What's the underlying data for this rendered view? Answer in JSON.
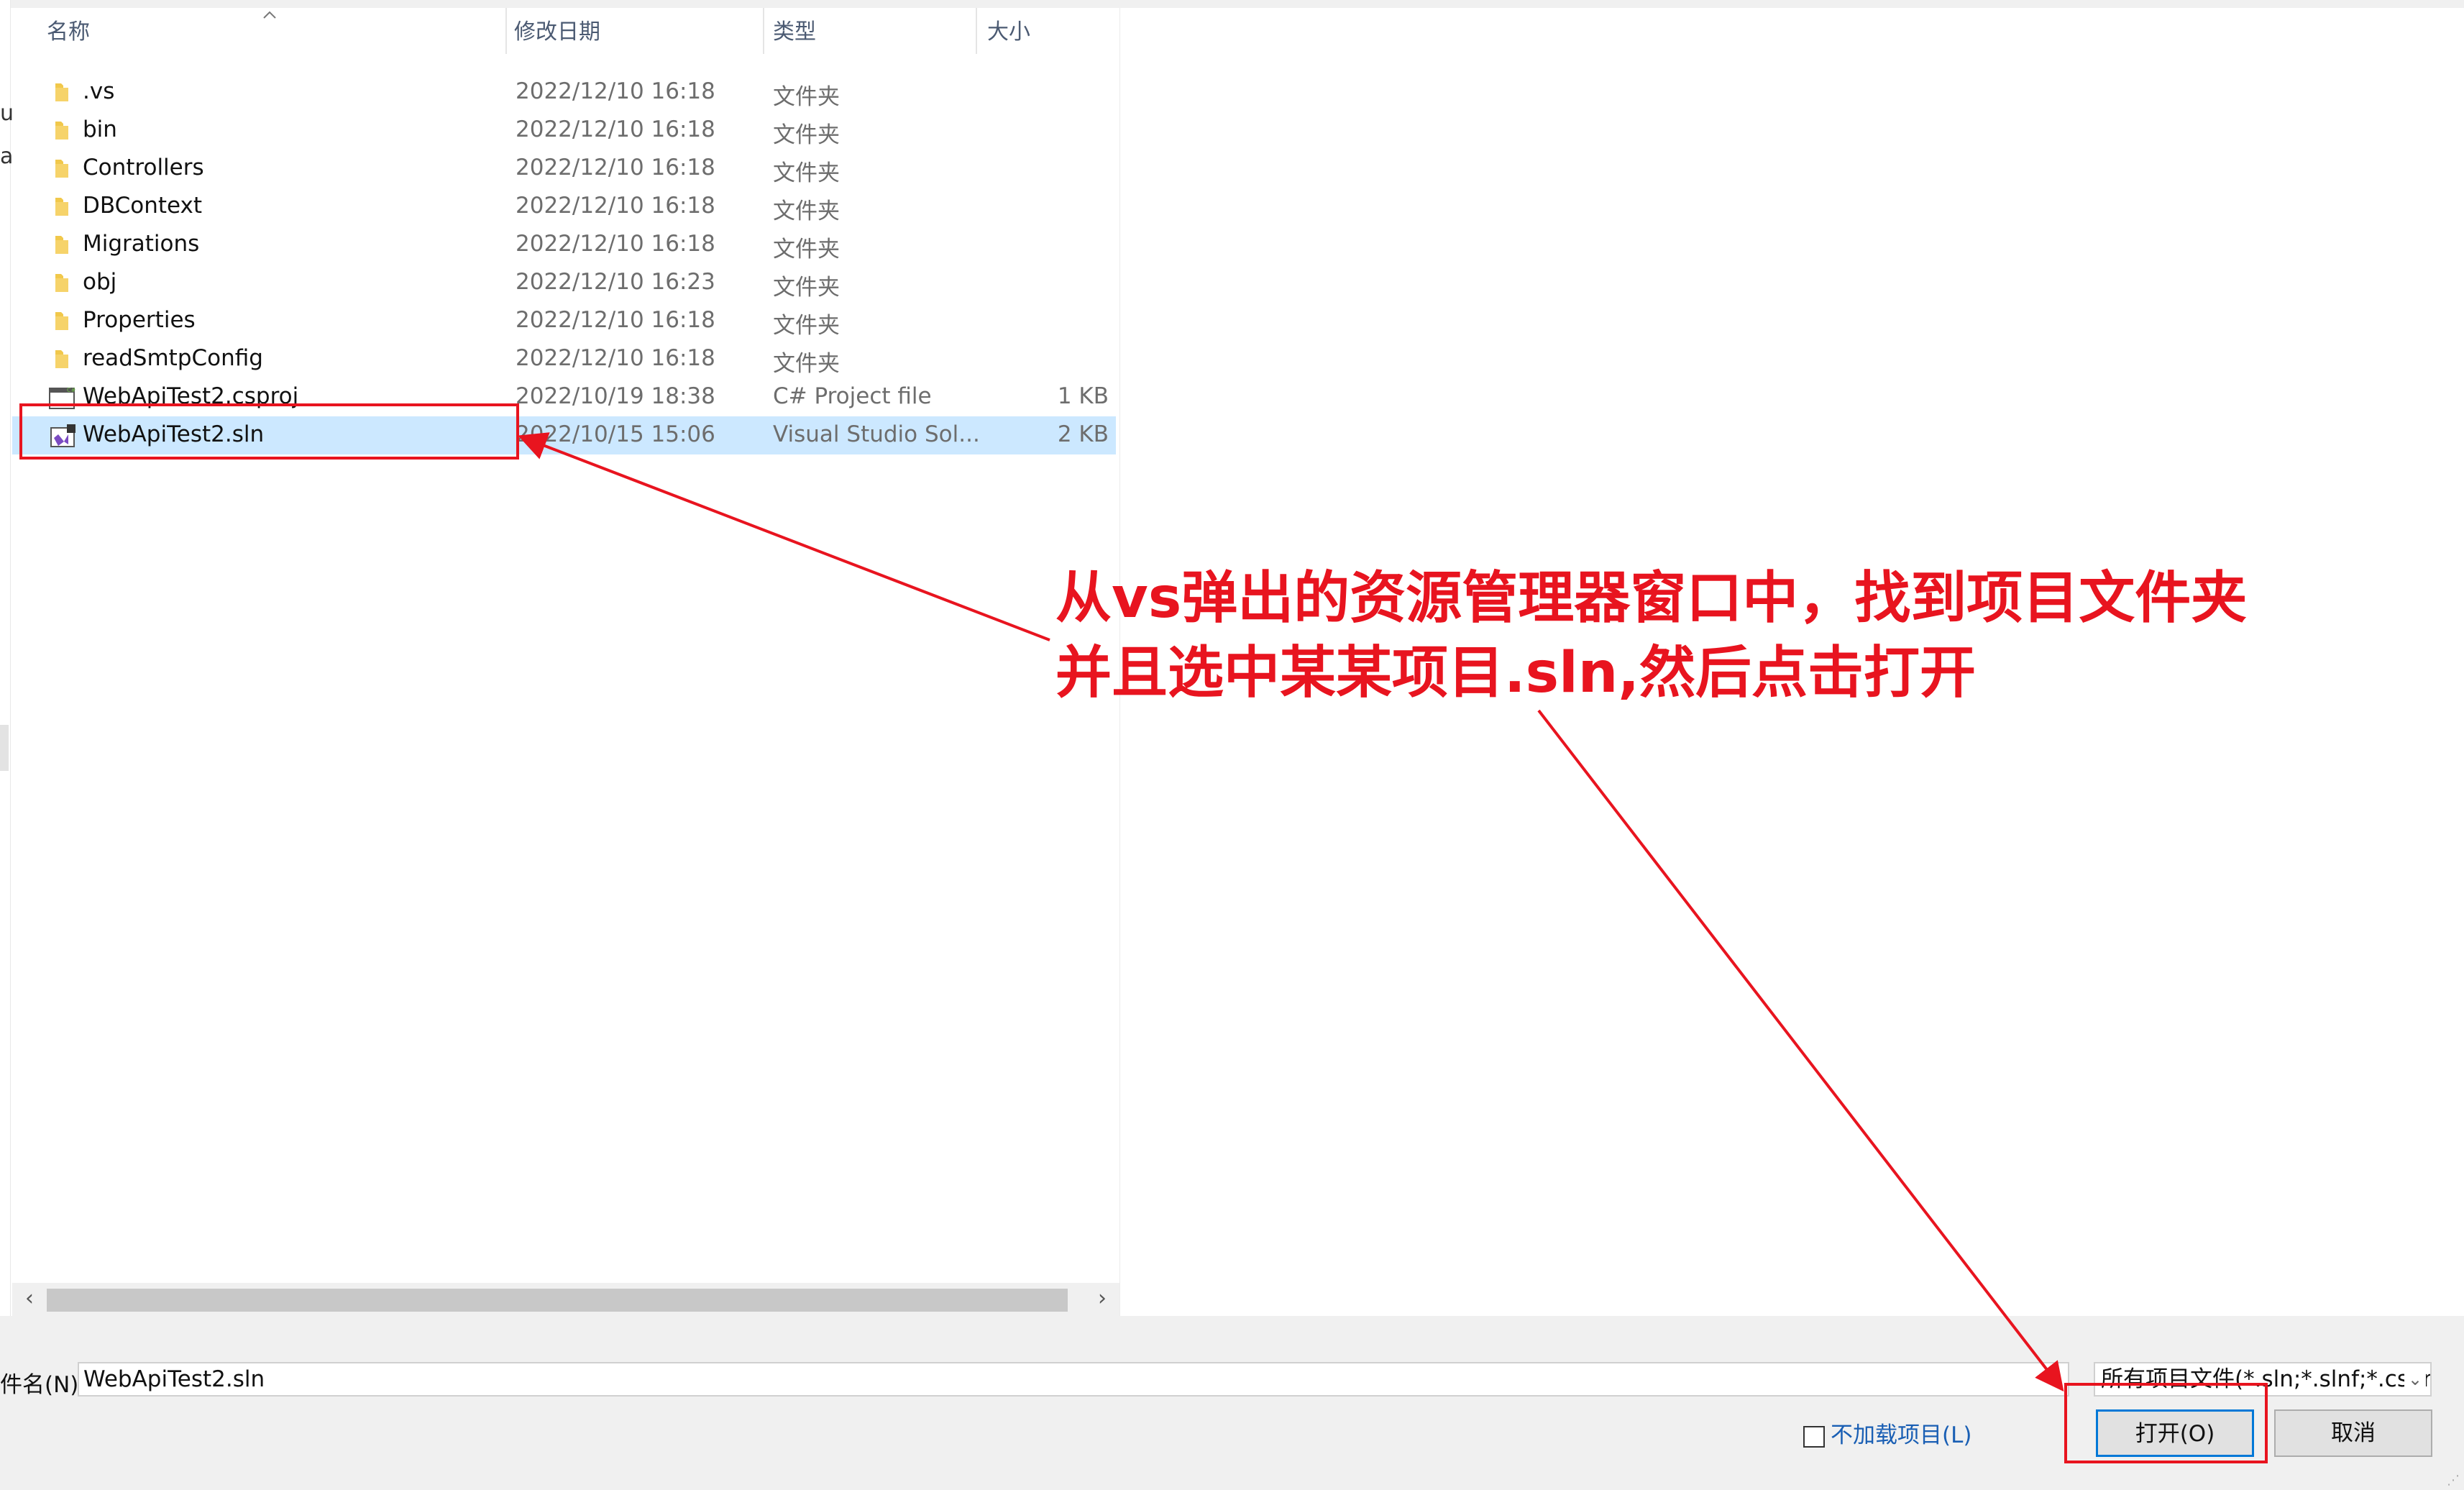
{
  "left_edge": {
    "fragments": [
      "u",
      "al"
    ]
  },
  "columns": {
    "name": "名称",
    "date": "修改日期",
    "type": "类型",
    "size": "大小"
  },
  "files": [
    {
      "icon": "folder-icon",
      "name": ".vs",
      "date": "2022/12/10 16:18",
      "type": "文件夹",
      "size": ""
    },
    {
      "icon": "folder-icon",
      "name": "bin",
      "date": "2022/12/10 16:18",
      "type": "文件夹",
      "size": ""
    },
    {
      "icon": "folder-icon",
      "name": "Controllers",
      "date": "2022/12/10 16:18",
      "type": "文件夹",
      "size": ""
    },
    {
      "icon": "folder-icon",
      "name": "DBContext",
      "date": "2022/12/10 16:18",
      "type": "文件夹",
      "size": ""
    },
    {
      "icon": "folder-icon",
      "name": "Migrations",
      "date": "2022/12/10 16:18",
      "type": "文件夹",
      "size": ""
    },
    {
      "icon": "folder-icon",
      "name": "obj",
      "date": "2022/12/10 16:23",
      "type": "文件夹",
      "size": ""
    },
    {
      "icon": "folder-icon",
      "name": "Properties",
      "date": "2022/12/10 16:18",
      "type": "文件夹",
      "size": ""
    },
    {
      "icon": "folder-icon",
      "name": "readSmtpConfig",
      "date": "2022/12/10 16:18",
      "type": "文件夹",
      "size": ""
    },
    {
      "icon": "csproj-file-icon",
      "name": "WebApiTest2.csproj",
      "date": "2022/10/19 18:38",
      "type": "C# Project file",
      "size": "1 KB"
    },
    {
      "icon": "vs-solution-file-icon",
      "name": "WebApiTest2.sln",
      "date": "2022/10/15 15:06",
      "type": "Visual Studio Sol...",
      "size": "2 KB",
      "selected": true
    }
  ],
  "bottom": {
    "filename_label": "件名(N):",
    "filename_value": "WebApiTest2.sln",
    "filetype_value": "所有项目文件(*.sln;*.slnf;*.cspro",
    "no_load_label": "不加载项目(L)",
    "open_label": "打开(O)",
    "cancel_label": "取消"
  },
  "annotation": {
    "line1": "从vs弹出的资源管理器窗口中，找到项目文件夹",
    "line2": "并且选中某某项目.sln,然后点击打开"
  },
  "colors": {
    "annotation": "#e8141f",
    "selection": "#cce8ff",
    "accent": "#0078d7"
  }
}
